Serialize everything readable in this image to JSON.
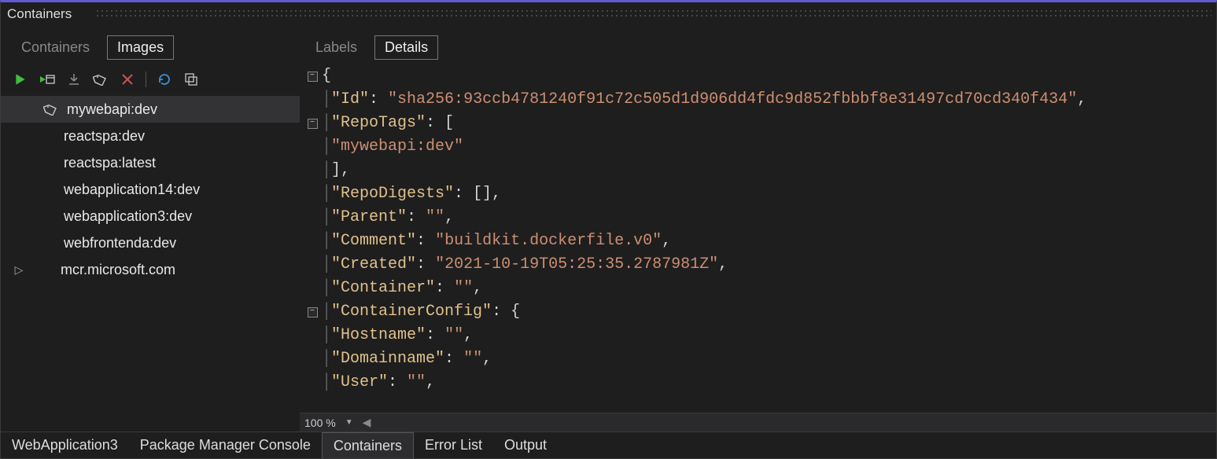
{
  "title": "Containers",
  "leftTabs": {
    "containers": "Containers",
    "images": "Images",
    "activeIndex": 1
  },
  "rightTabs": {
    "labels": "Labels",
    "details": "Details",
    "activeIndex": 1
  },
  "toolbar": {
    "run": "run",
    "runWithWindow": "run-attach",
    "download": "download",
    "tag": "tag",
    "delete": "delete",
    "refresh": "refresh",
    "copy": "copy-to"
  },
  "images": [
    {
      "name": "mywebapi:dev",
      "tagged": true
    },
    {
      "name": "reactspa:dev",
      "tagged": false
    },
    {
      "name": "reactspa:latest",
      "tagged": false
    },
    {
      "name": "webapplication14:dev",
      "tagged": false
    },
    {
      "name": "webapplication3:dev",
      "tagged": false
    },
    {
      "name": "webfrontenda:dev",
      "tagged": false
    }
  ],
  "registry": {
    "name": "mcr.microsoft.com"
  },
  "selectedIndex": 0,
  "details": {
    "Id": "sha256:93ccb4781240f91c72c505d1d906dd4fdc9d852fbbbf8e31497cd70cd340f434",
    "RepoTags": [
      "mywebapi:dev"
    ],
    "RepoDigests": [],
    "Parent": "",
    "Comment": "buildkit.dockerfile.v0",
    "Created": "2021-10-19T05:25:35.2787981Z",
    "Container": "",
    "ContainerConfig": {
      "Hostname": "",
      "Domainname": "",
      "User": ""
    }
  },
  "zoom": "100 %",
  "bottomTabs": [
    "WebApplication3",
    "Package Manager Console",
    "Containers",
    "Error List",
    "Output"
  ],
  "bottomActiveIndex": 2
}
